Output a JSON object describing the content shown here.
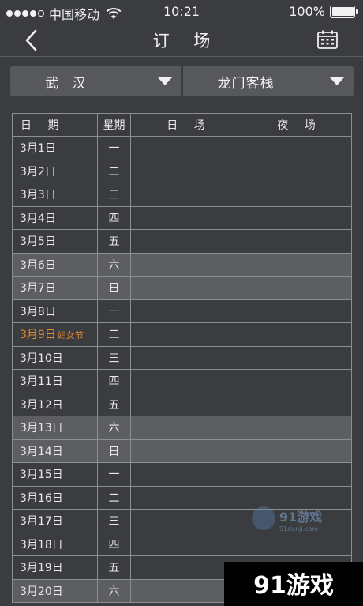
{
  "status_bar": {
    "carrier": "中国移动",
    "time": "10:21",
    "battery": "100%",
    "battery_level": 1.0,
    "signal_dots": 5,
    "signal_filled": 4
  },
  "nav": {
    "title": "订 场",
    "back_icon": "chevron-left-icon",
    "calendar_icon": "calendar-icon"
  },
  "selectors": {
    "city": "武 汉",
    "venue": "龙门客栈"
  },
  "table": {
    "headers": {
      "date": "日 期",
      "weekday": "星期",
      "day": "日 场",
      "night": "夜 场"
    },
    "rows": [
      {
        "date": "3月1日",
        "weekday": "一",
        "weekend": false,
        "tag": ""
      },
      {
        "date": "3月2日",
        "weekday": "二",
        "weekend": false,
        "tag": ""
      },
      {
        "date": "3月3日",
        "weekday": "三",
        "weekend": false,
        "tag": ""
      },
      {
        "date": "3月4日",
        "weekday": "四",
        "weekend": false,
        "tag": ""
      },
      {
        "date": "3月5日",
        "weekday": "五",
        "weekend": false,
        "tag": ""
      },
      {
        "date": "3月6日",
        "weekday": "六",
        "weekend": true,
        "tag": ""
      },
      {
        "date": "3月7日",
        "weekday": "日",
        "weekend": true,
        "tag": ""
      },
      {
        "date": "3月8日",
        "weekday": "一",
        "weekend": false,
        "tag": ""
      },
      {
        "date": "3月9日",
        "weekday": "二",
        "weekend": false,
        "tag": "妇女节"
      },
      {
        "date": "3月10日",
        "weekday": "三",
        "weekend": false,
        "tag": ""
      },
      {
        "date": "3月11日",
        "weekday": "四",
        "weekend": false,
        "tag": ""
      },
      {
        "date": "3月12日",
        "weekday": "五",
        "weekend": false,
        "tag": ""
      },
      {
        "date": "3月13日",
        "weekday": "六",
        "weekend": true,
        "tag": ""
      },
      {
        "date": "3月14日",
        "weekday": "日",
        "weekend": true,
        "tag": ""
      },
      {
        "date": "3月15日",
        "weekday": "一",
        "weekend": false,
        "tag": ""
      },
      {
        "date": "3月16日",
        "weekday": "二",
        "weekend": false,
        "tag": ""
      },
      {
        "date": "3月17日",
        "weekday": "三",
        "weekend": false,
        "tag": ""
      },
      {
        "date": "3月18日",
        "weekday": "四",
        "weekend": false,
        "tag": ""
      },
      {
        "date": "3月19日",
        "weekday": "五",
        "weekend": false,
        "tag": ""
      },
      {
        "date": "3月20日",
        "weekday": "六",
        "weekend": true,
        "tag": ""
      }
    ]
  },
  "watermark": {
    "small_text": "91游戏",
    "small_sub": "91danji.com",
    "big_text": "91游戏"
  },
  "colors": {
    "background": "#3a3c3f",
    "weekend_row": "#5c5e62",
    "holiday": "#e08a2c",
    "grid": "#8c8e92"
  }
}
